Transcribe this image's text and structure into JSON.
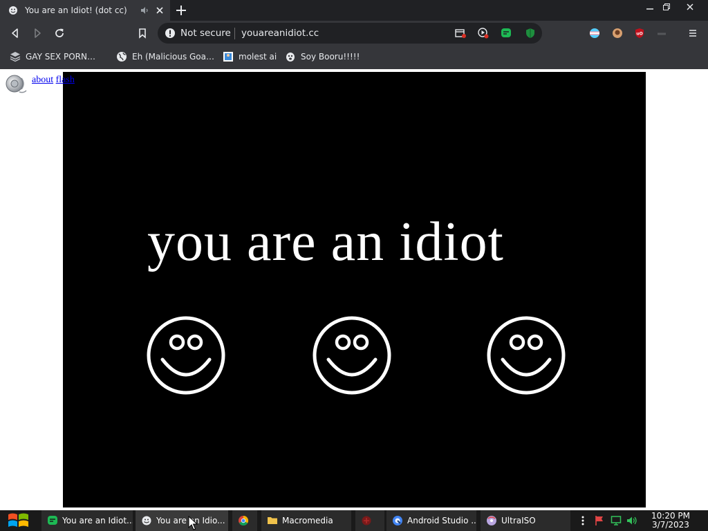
{
  "browser": {
    "tab": {
      "title": "You are an Idiot! (dot cc)",
      "favicon": "smiley-icon"
    },
    "address": {
      "security_label": "Not secure",
      "url": "youareanidiot.cc"
    },
    "bookmarks": [
      {
        "label": "GAY SEX PORN…",
        "icon": "layers-icon"
      },
      {
        "label": "Eh (Malicious Goa…",
        "icon": "globe-icon"
      },
      {
        "label": "molest ai",
        "icon": "image-icon"
      },
      {
        "label": "Soy Booru!!!!!",
        "icon": "soyjak-icon"
      }
    ],
    "colors": {
      "frame": "#202124",
      "toolbar": "#35363a",
      "text": "#e8eaed"
    }
  },
  "page": {
    "links": {
      "about": "about",
      "flash": "flash"
    },
    "headline": "you are an idiot",
    "smiley_count": 3,
    "colors": {
      "stage": "#000000",
      "foreground": "#ffffff",
      "link": "#0000ee"
    }
  },
  "taskbar": {
    "items": [
      {
        "label": "You are an Idiot...",
        "icon": "chat-icon"
      },
      {
        "label": "You are an Idio...",
        "icon": "smiley-icon"
      },
      {
        "label": "",
        "icon": "chrome-icon"
      },
      {
        "label": "Macromedia",
        "icon": "folder-icon"
      },
      {
        "label": "",
        "icon": "app-icon"
      },
      {
        "label": "Android Studio ...",
        "icon": "android-studio-icon"
      },
      {
        "label": "UltraISO",
        "icon": "disc-icon"
      }
    ],
    "clock": {
      "time": "10:20 PM",
      "date": "3/7/2023"
    }
  }
}
